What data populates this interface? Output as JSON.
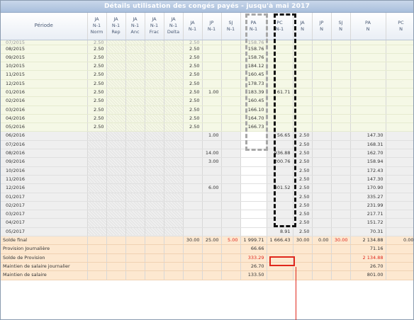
{
  "title": "Détails utilisation des congés payés - jusqu'à mai 2017",
  "columns": [
    {
      "l1": "Période",
      "l2": "",
      "l3": ""
    },
    {
      "l1": "JA",
      "l2": "N-1",
      "l3": "Norm"
    },
    {
      "l1": "JA",
      "l2": "N-1",
      "l3": "Rep"
    },
    {
      "l1": "JA",
      "l2": "N-1",
      "l3": "Anc"
    },
    {
      "l1": "JA",
      "l2": "N-1",
      "l3": "Frac"
    },
    {
      "l1": "JA",
      "l2": "N-1",
      "l3": "Delta"
    },
    {
      "l1": "JA",
      "l2": "N-1",
      "l3": ""
    },
    {
      "l1": "JP",
      "l2": "N-1",
      "l3": ""
    },
    {
      "l1": "SJ",
      "l2": "N-1",
      "l3": ""
    },
    {
      "l1": "PA",
      "l2": "N-1",
      "l3": ""
    },
    {
      "l1": "PC",
      "l2": "N-1",
      "l3": ""
    },
    {
      "l1": "JA",
      "l2": "N",
      "l3": ""
    },
    {
      "l1": "JP",
      "l2": "N",
      "l3": ""
    },
    {
      "l1": "SJ",
      "l2": "N",
      "l3": ""
    },
    {
      "l1": "PA",
      "l2": "N",
      "l3": ""
    },
    {
      "l1": "PC",
      "l2": "N",
      "l3": ""
    }
  ],
  "rows_n1": [
    [
      "08/2015",
      "2.50",
      "",
      "",
      "",
      "",
      "2.50",
      "",
      "",
      "158.76",
      "",
      "",
      "",
      "",
      "",
      ""
    ],
    [
      "09/2015",
      "2.50",
      "",
      "",
      "",
      "",
      "2.50",
      "",
      "",
      "158.76",
      "",
      "",
      "",
      "",
      "",
      ""
    ],
    [
      "10/2015",
      "2.50",
      "",
      "",
      "",
      "",
      "2.50",
      "",
      "",
      "184.12",
      "",
      "",
      "",
      "",
      "",
      ""
    ],
    [
      "11/2015",
      "2.50",
      "",
      "",
      "",
      "",
      "2.50",
      "",
      "",
      "160.45",
      "",
      "",
      "",
      "",
      "",
      ""
    ],
    [
      "12/2015",
      "2.50",
      "",
      "",
      "",
      "",
      "2.50",
      "",
      "",
      "178.73",
      "",
      "",
      "",
      "",
      "",
      ""
    ],
    [
      "01/2016",
      "2.50",
      "",
      "",
      "",
      "",
      "2.50",
      "1.00",
      "",
      "183.39",
      "61.71",
      "",
      "",
      "",
      "",
      ""
    ],
    [
      "02/2016",
      "2.50",
      "",
      "",
      "",
      "",
      "2.50",
      "",
      "",
      "160.45",
      "",
      "",
      "",
      "",
      "",
      ""
    ],
    [
      "03/2016",
      "2.50",
      "",
      "",
      "",
      "",
      "2.50",
      "",
      "",
      "166.10",
      "",
      "",
      "",
      "",
      "",
      ""
    ],
    [
      "04/2016",
      "2.50",
      "",
      "",
      "",
      "",
      "2.50",
      "",
      "",
      "164.70",
      "",
      "",
      "",
      "",
      "",
      ""
    ],
    [
      "05/2016",
      "2.50",
      "",
      "",
      "",
      "",
      "2.50",
      "",
      "",
      "166.73",
      "",
      "",
      "",
      "",
      "",
      ""
    ]
  ],
  "rows_n": [
    [
      "06/2016",
      "",
      "",
      "",
      "",
      "",
      "",
      "1.00",
      "",
      "",
      "56.65",
      "2.50",
      "",
      "",
      "147.30",
      ""
    ],
    [
      "07/2016",
      "",
      "",
      "",
      "",
      "",
      "",
      "",
      "",
      "",
      "",
      "2.50",
      "",
      "",
      "168.31",
      ""
    ],
    [
      "08/2016",
      "",
      "",
      "",
      "",
      "",
      "",
      "14.00",
      "",
      "",
      "936.88",
      "2.50",
      "",
      "",
      "162.70",
      ""
    ],
    [
      "09/2016",
      "",
      "",
      "",
      "",
      "",
      "",
      "3.00",
      "",
      "",
      "200.76",
      "2.50",
      "",
      "",
      "158.94",
      ""
    ],
    [
      "10/2016",
      "",
      "",
      "",
      "",
      "",
      "",
      "",
      "",
      "",
      "",
      "2.50",
      "",
      "",
      "172.43",
      ""
    ],
    [
      "11/2016",
      "",
      "",
      "",
      "",
      "",
      "",
      "",
      "",
      "",
      "",
      "2.50",
      "",
      "",
      "147.30",
      ""
    ],
    [
      "12/2016",
      "",
      "",
      "",
      "",
      "",
      "",
      "6.00",
      "",
      "",
      "401.52",
      "2.50",
      "",
      "",
      "170.90",
      ""
    ],
    [
      "01/2017",
      "",
      "",
      "",
      "",
      "",
      "",
      "",
      "",
      "",
      "",
      "2.50",
      "",
      "",
      "335.27",
      ""
    ],
    [
      "02/2017",
      "",
      "",
      "",
      "",
      "",
      "",
      "",
      "",
      "",
      "",
      "2.50",
      "",
      "",
      "231.99",
      ""
    ],
    [
      "03/2017",
      "",
      "",
      "",
      "",
      "",
      "",
      "",
      "",
      "",
      "",
      "2.50",
      "",
      "",
      "217.71",
      ""
    ],
    [
      "04/2017",
      "",
      "",
      "",
      "",
      "",
      "",
      "",
      "",
      "",
      "",
      "2.50",
      "",
      "",
      "151.72",
      ""
    ],
    [
      "05/2017",
      "",
      "",
      "",
      "",
      "",
      "",
      "",
      "",
      "",
      "8.91",
      "2.50",
      "",
      "",
      "70.31",
      ""
    ]
  ],
  "summary": [
    {
      "label": "Solde final",
      "cells": [
        "",
        "",
        "",
        "",
        "",
        "30.00",
        "25.00",
        "5.00",
        "1 999.71",
        "1 666.43",
        "30.00",
        "0.00",
        "30.00",
        "2 134.88",
        "0.00"
      ],
      "red": [
        7,
        12
      ]
    },
    {
      "label": "Provision Journalière",
      "cells": [
        "",
        "",
        "",
        "",
        "",
        "",
        "",
        "",
        "66.66",
        "",
        "",
        "",
        "",
        "71.16",
        ""
      ],
      "red": []
    },
    {
      "label": "Solde de Provision",
      "cells": [
        "",
        "",
        "",
        "",
        "",
        "",
        "",
        "",
        "333.29",
        "",
        "",
        "",
        "",
        "2 134.88",
        ""
      ],
      "red": [
        8,
        13
      ]
    },
    {
      "label": "Maintien de salaire journalier",
      "cells": [
        "",
        "",
        "",
        "",
        "",
        "",
        "",
        "",
        "26.70",
        "",
        "",
        "",
        "",
        "26.70",
        ""
      ],
      "red": []
    },
    {
      "label": "Maintien de salaire",
      "cells": [
        "",
        "",
        "",
        "",
        "",
        "",
        "",
        "",
        "133.50",
        "",
        "",
        "",
        "",
        "801.00",
        ""
      ],
      "red": []
    }
  ],
  "colors": {
    "red_accent": "#e0271c",
    "n1_bg": "#f5f8e6",
    "n_bg": "#efefef",
    "summary_bg": "#fde8d0"
  }
}
